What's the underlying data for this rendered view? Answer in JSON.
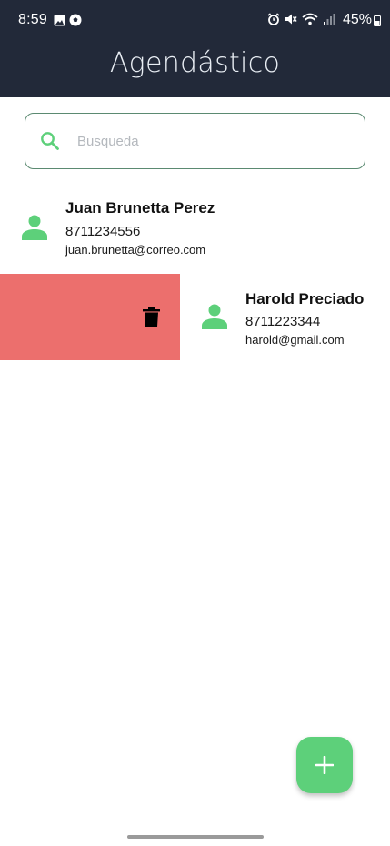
{
  "status_bar": {
    "time": "8:59",
    "battery": "45%",
    "icons": [
      "image-icon",
      "soccer-ball-icon",
      "alarm-icon",
      "mute-icon",
      "wifi-icon",
      "signal-icon",
      "battery-icon"
    ]
  },
  "app_bar": {
    "title": "Agendástico"
  },
  "search": {
    "placeholder": "Busqueda",
    "value": ""
  },
  "contacts": [
    {
      "name": "Juan Brunetta Perez",
      "phone": "8711234556",
      "email": "juan.brunetta@correo.com"
    },
    {
      "name": "Harold Preciado",
      "phone": "8711223344",
      "email": "harold@gmail.com",
      "swiped": true
    }
  ],
  "colors": {
    "app_bar": "#222939",
    "accent_green": "#5dd07a",
    "delete_red": "#ec6f6d",
    "search_border": "#5b8a71"
  },
  "fab": {
    "icon": "plus-icon"
  }
}
